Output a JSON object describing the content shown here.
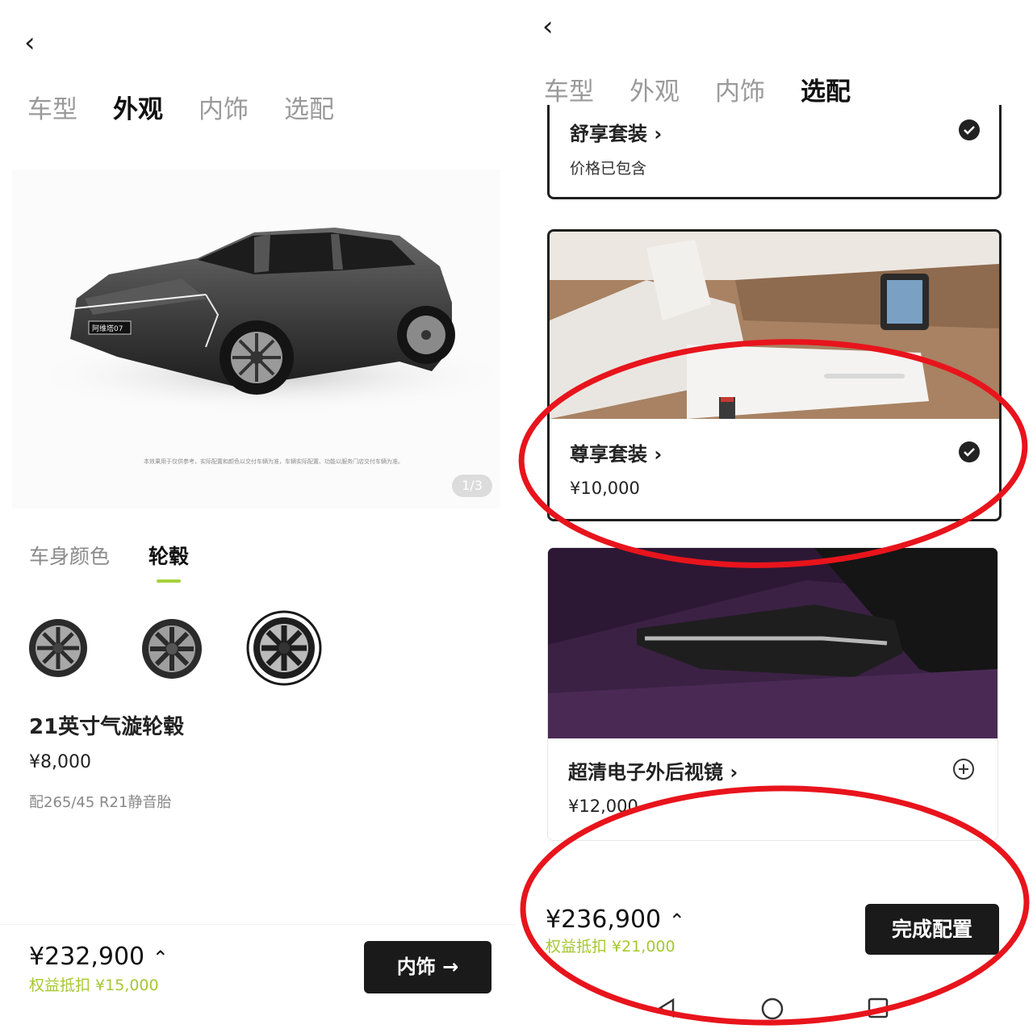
{
  "left": {
    "tabs": [
      "车型",
      "外观",
      "内饰",
      "选配"
    ],
    "active_tab": 1,
    "car_badge": "阿维塔07",
    "disclaimer": "本效果用于仅供参考，实际配置和颜色以交付车辆为准，车辆实际配置、功能以服务门店交付车辆为准。",
    "pager": "1/3",
    "subtabs": [
      "车身颜色",
      "轮毂"
    ],
    "active_subtab": 1,
    "wheel_name": "21英寸气漩轮毂",
    "wheel_price": "¥8,000",
    "wheel_note": "配265/45 R21静音胎",
    "total": "¥232,900",
    "discount": "权益抵扣 ¥15,000",
    "next_button": "内饰 →"
  },
  "right": {
    "tabs": [
      "车型",
      "外观",
      "内饰",
      "选配"
    ],
    "active_tab": 3,
    "packages": [
      {
        "title": "舒享套装 ›",
        "subtitle": "价格已包含",
        "selected": true
      },
      {
        "title": "尊享套装 ›",
        "price": "¥10,000",
        "selected": true
      },
      {
        "title": "超清电子外后视镜 ›",
        "price": "¥12,000",
        "selected": false
      }
    ],
    "total": "¥236,900",
    "discount": "权益抵扣 ¥21,000",
    "finish_button": "完成配置"
  },
  "colors": {
    "accent_green": "#a6d23b",
    "discount_green": "#a6c832",
    "annotation_red": "#e8141c",
    "button_dark": "#1a1a1a"
  }
}
